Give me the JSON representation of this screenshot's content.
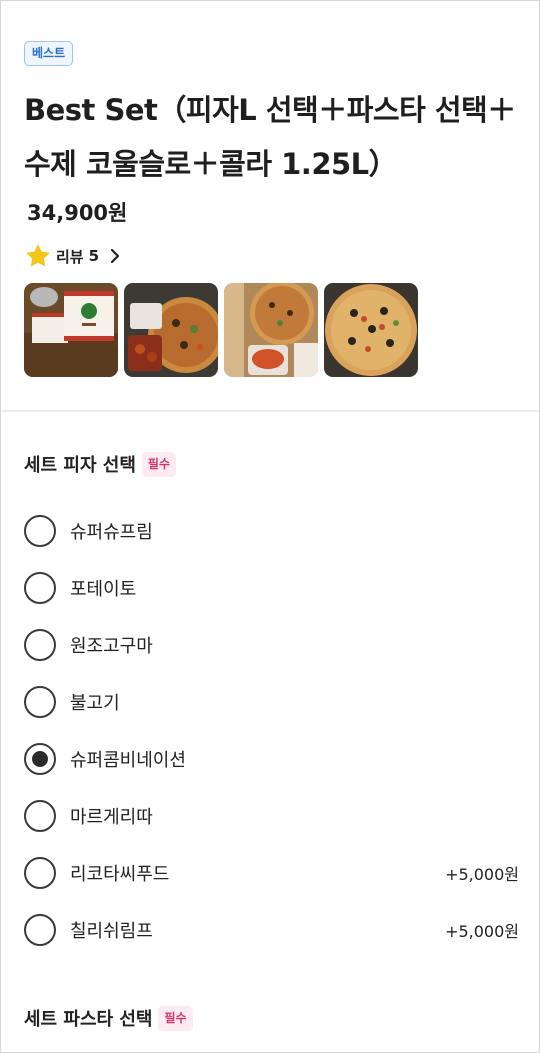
{
  "product": {
    "badge": "베스트",
    "title": "Best Set（피자L 선택＋파스타 선택＋수제 코울슬로＋콜라 1.25L）",
    "price": "34,900원",
    "review_label": "리뷰",
    "review_count": "5",
    "accent_color": "#f5c518"
  },
  "sections": [
    {
      "title": "세트 피자 선택",
      "required_label": "필수",
      "options": [
        {
          "label": "슈퍼슈프림",
          "price": "",
          "selected": false
        },
        {
          "label": "포테이토",
          "price": "",
          "selected": false
        },
        {
          "label": "원조고구마",
          "price": "",
          "selected": false
        },
        {
          "label": "불고기",
          "price": "",
          "selected": false
        },
        {
          "label": "슈퍼콤비네이션",
          "price": "",
          "selected": true
        },
        {
          "label": "마르게리따",
          "price": "",
          "selected": false
        },
        {
          "label": "리코타씨푸드",
          "price": "+5,000원",
          "selected": false
        },
        {
          "label": "칠리쉬림프",
          "price": "+5,000원",
          "selected": false
        }
      ]
    },
    {
      "title": "세트 파스타 선택",
      "required_label": "필수"
    }
  ],
  "icons": {
    "star": "star-icon",
    "chevron": "chevron-right-icon",
    "radio": "radio-button"
  }
}
